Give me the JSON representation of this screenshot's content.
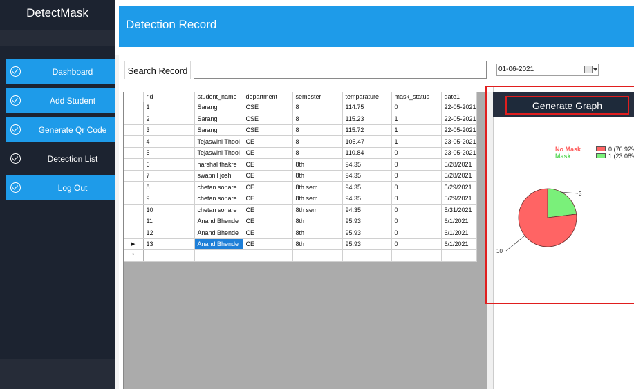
{
  "app": {
    "brand": "DetectMask"
  },
  "sidebar": {
    "items": [
      {
        "label": "Dashboard",
        "active": true
      },
      {
        "label": "Add Student",
        "active": true
      },
      {
        "label": "Generate Qr Code",
        "active": true
      },
      {
        "label": "Detection List",
        "active": false
      },
      {
        "label": "Log Out",
        "active": true
      }
    ]
  },
  "header": {
    "title": "Detection Record"
  },
  "search": {
    "label": "Search Record",
    "value": "",
    "date": "01-06-2021"
  },
  "table": {
    "columns": [
      "rid",
      "student_name",
      "department",
      "semester",
      "temparature",
      "mask_status",
      "date1"
    ],
    "rows": [
      [
        "1",
        "Sarang",
        "CSE",
        "8",
        "114.75",
        "0",
        "22-05-2021"
      ],
      [
        "2",
        "Sarang",
        "CSE",
        "8",
        "115.23",
        "1",
        "22-05-2021"
      ],
      [
        "3",
        "Sarang",
        "CSE",
        "8",
        "115.72",
        "1",
        "22-05-2021"
      ],
      [
        "4",
        "Tejaswini Thool",
        "CE",
        "8",
        "105.47",
        "1",
        "23-05-2021"
      ],
      [
        "5",
        "Tejaswini Thool",
        "CE",
        "8",
        "110.84",
        "0",
        "23-05-2021"
      ],
      [
        "6",
        "harshal thakre",
        "CE",
        "8th",
        "94.35",
        "0",
        "5/28/2021"
      ],
      [
        "7",
        "swapnil joshi",
        "CE",
        "8th",
        "94.35",
        "0",
        "5/28/2021"
      ],
      [
        "8",
        "chetan sonare",
        "CE",
        "8th sem",
        "94.35",
        "0",
        "5/29/2021"
      ],
      [
        "9",
        "chetan sonare",
        "CE",
        "8th sem",
        "94.35",
        "0",
        "5/29/2021"
      ],
      [
        "10",
        "chetan sonare",
        "CE",
        "8th sem",
        "94.35",
        "0",
        "5/31/2021"
      ],
      [
        "11",
        "Anand Bhende",
        "CE",
        "8th",
        "95.93",
        "0",
        "6/1/2021"
      ],
      [
        "12",
        "Anand Bhende",
        "CE",
        "8th",
        "95.93",
        "0",
        "6/1/2021"
      ],
      [
        "13",
        "Anand Bhende",
        "CE",
        "8th",
        "95.93",
        "0",
        "6/1/2021"
      ]
    ],
    "current_row_marker": "▶",
    "new_row_marker": "*"
  },
  "graph": {
    "button_label": "Generate Graph",
    "colors": {
      "no_mask": "#ff6464",
      "mask": "#7af07a",
      "accent": "#1e9be9",
      "highlight": "#e01e1e"
    }
  },
  "chart_data": {
    "type": "pie",
    "series": [
      {
        "name": "No Mask",
        "legend_text": "0 (76.92%",
        "value": 10
      },
      {
        "name": "Mask",
        "legend_text": "1 (23.08%",
        "value": 3
      }
    ],
    "data_labels": [
      "10",
      "3"
    ]
  }
}
